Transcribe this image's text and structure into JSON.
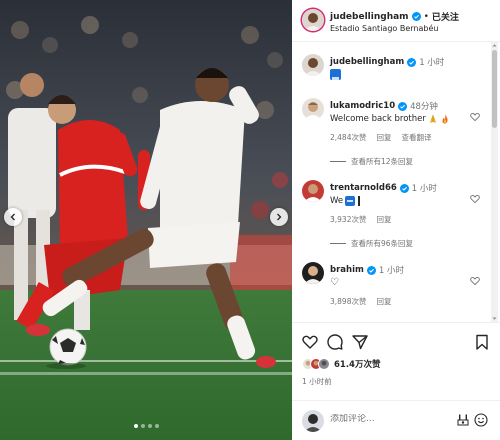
{
  "post": {
    "username": "judebellingham",
    "separator": "•",
    "follow_status": "已关注",
    "location": "Estadio Santiago Bernabéu",
    "caption_username": "judebellingham",
    "caption_time": "1 小时",
    "caption_icon": "blue-emoji-square-icon"
  },
  "comments": [
    {
      "username": "lukamodric10",
      "time": "48分钟",
      "text": "Welcome back brother",
      "emojis": [
        "praying-hands-icon",
        "fire-icon"
      ],
      "likes": "2,484次赞",
      "reply_label": "回复",
      "translate_label": "查看翻译",
      "view_replies": "查看所有12条回复"
    },
    {
      "username": "trentarnold66",
      "time": "1 小时",
      "text": "We",
      "emojis": [
        "blue-square-icon",
        "vertical-bar-icon"
      ],
      "likes": "3,932次赞",
      "reply_label": "回复",
      "view_replies": "查看所有96条回复"
    },
    {
      "username": "brahim",
      "time": "1 小时",
      "text": "♡",
      "likes": "3,898次赞",
      "reply_label": "回复"
    }
  ],
  "actions": {
    "like_icon": "heart-icon",
    "comment_icon": "comment-icon",
    "share_icon": "send-icon",
    "save_icon": "bookmark-icon",
    "likes_count": "61.4万次赞",
    "post_time": "1 小时前"
  },
  "add_comment": {
    "placeholder": "添加评论..."
  },
  "media": {
    "slide_count": 4,
    "active_slide": 1
  },
  "colors": {
    "verified": "#0095f6",
    "link": "#0095f6",
    "muted": "#737373",
    "story_ring": "#d62976"
  }
}
